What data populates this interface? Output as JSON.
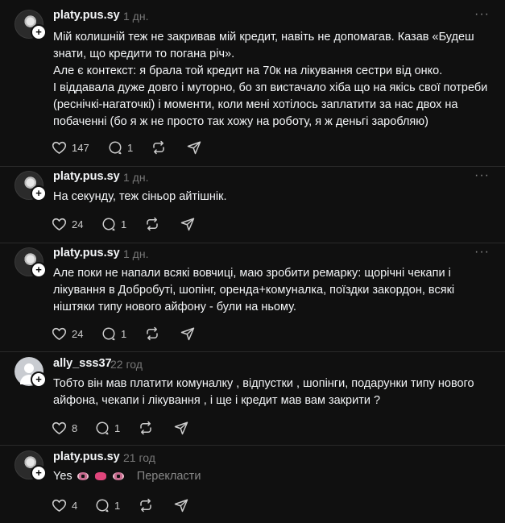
{
  "posts": [
    {
      "username": "platy.pus.sy",
      "time": "1 дн.",
      "paragraphs": [
        "Мій колишній теж не закривав мій кредит, навіть не допомагав. Казав «Будеш знати, що кредити то погана річ».",
        "Але є контекст: я брала той кредит на 70к на лікування сестри від онко.",
        "І віддавала дуже довго і муторно, бо зп вистачало хіба що на якісь свої потреби (реснічкі-нагаточкі) і моменти, коли мені хотілось заплатити за нас двох на побаченні (бо я ж не просто так хожу на роботу, я ж деньгі заробляю)"
      ],
      "likes": "147",
      "replies": "1"
    },
    {
      "username": "platy.pus.sy",
      "time": "1 дн.",
      "paragraphs": [
        "На секунду, теж сіньор айтішнік."
      ],
      "likes": "24",
      "replies": "1"
    },
    {
      "username": "platy.pus.sy",
      "time": "1 дн.",
      "paragraphs": [
        "Але поки не напали всякі вовчиці, маю зробити ремарку: щорічні чекапи і лікування в Добробуті, шопінг, оренда+комуналка, поїздки закордон, всякі ніштяки типу нового айфону - були на ньому."
      ],
      "likes": "24",
      "replies": "1"
    },
    {
      "username": "ally_sss37",
      "time": "22 год",
      "paragraphs": [
        "Тобто він мав платити комуналку , відпустки , шопінги, подарунки типу нового айфона, чекапи і лікування , і ще і кредит мав вам закрити ?"
      ],
      "likes": "8",
      "replies": "1"
    },
    {
      "username": "platy.pus.sy",
      "time": "21 год",
      "paragraphs": [
        "Yes"
      ],
      "translate": "Перекласти",
      "likes": "4",
      "replies": "1"
    }
  ],
  "icons": {
    "like": "heart-icon",
    "reply": "comment-icon",
    "repost": "repost-icon",
    "share": "share-icon",
    "more": "more-icon",
    "follow": "plus-icon"
  },
  "more_glyph": "···",
  "plus_glyph": "+"
}
